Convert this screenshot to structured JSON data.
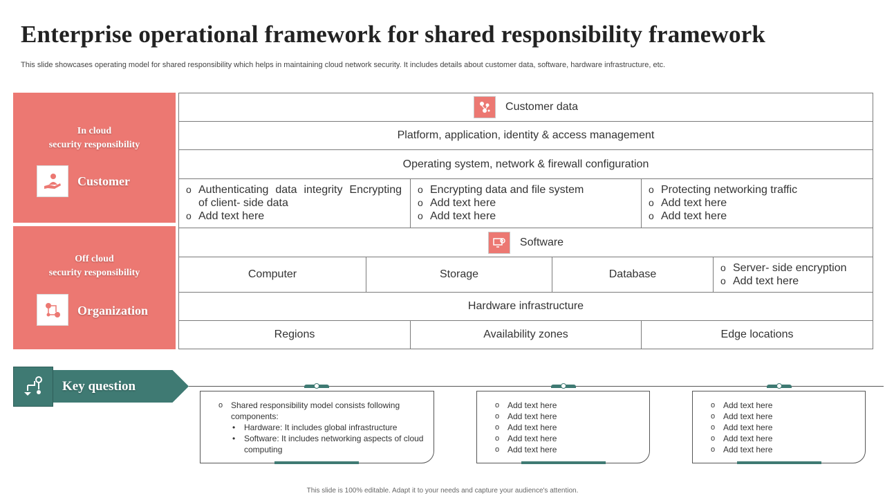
{
  "title": "Enterprise operational framework for shared responsibility framework",
  "subtitle": "This slide showcases operating model for shared responsibility which helps in maintaining cloud network security. It includes details about customer data, software, hardware infrastructure, etc.",
  "colors": {
    "accent_red": "#ec7872",
    "accent_teal": "#3f7a73"
  },
  "side": {
    "customer": {
      "caption_line1": "In cloud",
      "caption_line2": "security responsibility",
      "role": "Customer",
      "icon": "hand-user-icon"
    },
    "organization": {
      "caption_line1": "Off cloud",
      "caption_line2": "security responsibility",
      "role": "Organization",
      "icon": "network-nodes-icon"
    }
  },
  "grid": {
    "customer_data": "Customer data",
    "platform": "Platform, application, identity & access management",
    "os": "Operating system, network & firewall configuration",
    "col1": [
      "Authenticating data integrity Encrypting of client- side data",
      "Add text here"
    ],
    "col2": [
      "Encrypting data and file system",
      "Add text here",
      "Add text here"
    ],
    "col3": [
      "Protecting networking traffic",
      "Add text here",
      "Add text here"
    ],
    "software": "Software",
    "computer": "Computer",
    "storage": "Storage",
    "database": "Database",
    "encryption": [
      "Server- side encryption",
      "Add text here"
    ],
    "hardware": "Hardware infrastructure",
    "regions": "Regions",
    "zones": "Availability zones",
    "edge": "Edge locations"
  },
  "key_question": {
    "label": "Key question",
    "box1": {
      "item": "Shared responsibility model consists following components:",
      "sub": [
        "Hardware:  It includes global infrastructure",
        "Software:  It includes networking aspects of cloud computing"
      ]
    },
    "box2": [
      "Add text here",
      "Add text here",
      "Add text here",
      "Add text here",
      "Add text here"
    ],
    "box3": [
      "Add text here",
      "Add text here",
      "Add text here",
      "Add text here",
      "Add text here"
    ]
  },
  "footer": "This slide is 100% editable. Adapt it to your needs and capture your audience's attention."
}
